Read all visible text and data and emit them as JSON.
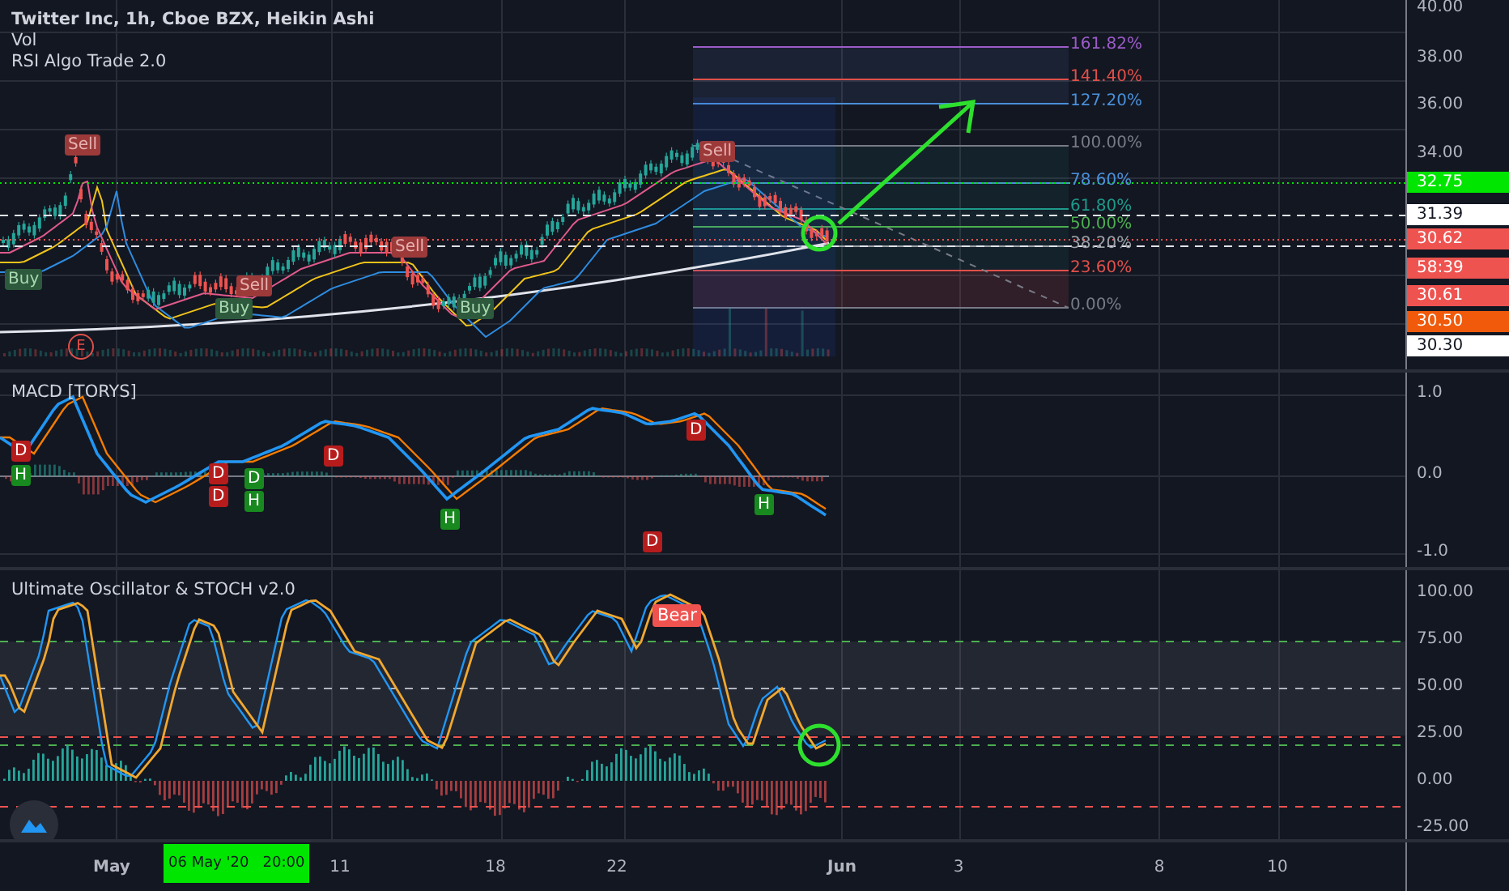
{
  "chart": {
    "legend": {
      "title": "Twitter Inc, 1h, Cboe BZX, Heikin Ashi",
      "indicators": [
        "Vol",
        "RSI Algo Trade 2.0"
      ]
    },
    "price_axis": [
      {
        "label": "40.00",
        "kind": "tick"
      },
      {
        "label": "38.00",
        "kind": "tick"
      },
      {
        "label": "36.00",
        "kind": "tick"
      },
      {
        "label": "34.00",
        "kind": "tick"
      },
      {
        "label": "32.75",
        "kind": "badge",
        "color": "#00e600"
      },
      {
        "label": "31.39",
        "kind": "badge",
        "color": "#ffffff"
      },
      {
        "label": "30.62",
        "kind": "badge",
        "color": "#ef5350"
      },
      {
        "label": "58:39",
        "kind": "badge",
        "color": "#ef5350"
      },
      {
        "label": "30.61",
        "kind": "badge",
        "color": "#ef5350"
      },
      {
        "label": "30.50",
        "kind": "badge",
        "color": "#f05a0a"
      },
      {
        "label": "30.30",
        "kind": "badge",
        "color": "#ffffff"
      }
    ],
    "fib_levels": [
      {
        "label": "161.82%",
        "color": "#9c5cc8"
      },
      {
        "label": "141.40%",
        "color": "#e0504a"
      },
      {
        "label": "127.20%",
        "color": "#4a90d9"
      },
      {
        "label": "100.00%",
        "color": "#787b86"
      },
      {
        "label": "78.60%",
        "color": "#4a90d9"
      },
      {
        "label": "61.80%",
        "color": "#1e9a8a"
      },
      {
        "label": "50.00%",
        "color": "#4caf50"
      },
      {
        "label": "38.20%",
        "color": "#9aa0a6"
      },
      {
        "label": "23.60%",
        "color": "#e0504a"
      },
      {
        "label": "0.00%",
        "color": "#787b86"
      }
    ],
    "signals": [
      {
        "label": "Sell",
        "kind": "sell"
      },
      {
        "label": "Buy",
        "kind": "buy"
      },
      {
        "label": "Sell",
        "kind": "sell"
      },
      {
        "label": "Buy",
        "kind": "buy"
      },
      {
        "label": "Sell",
        "kind": "sell"
      },
      {
        "label": "Buy",
        "kind": "buy"
      },
      {
        "label": "Sell",
        "kind": "sell"
      }
    ],
    "earnings_marker": "E"
  },
  "macd": {
    "title": "MACD [TORYS]",
    "axis": [
      "1.0",
      "0.0",
      "-1.0"
    ],
    "signals": [
      {
        "label": "D",
        "kind": "bearish"
      },
      {
        "label": "H",
        "kind": "bullish"
      },
      {
        "label": "D",
        "kind": "bearish"
      },
      {
        "label": "D",
        "kind": "bearish"
      },
      {
        "label": "D",
        "kind": "bullish"
      },
      {
        "label": "H",
        "kind": "bullish"
      },
      {
        "label": "D",
        "kind": "bearish"
      },
      {
        "label": "H",
        "kind": "bullish"
      },
      {
        "label": "D",
        "kind": "bearish"
      },
      {
        "label": "H",
        "kind": "bullish"
      },
      {
        "label": "D",
        "kind": "bearish"
      }
    ]
  },
  "oscillator": {
    "title": "Ultimate Oscillator & STOCH v2.0",
    "axis": [
      "100.00",
      "75.00",
      "50.00",
      "25.00",
      "0.00",
      "-25.00"
    ],
    "signals": [
      {
        "label": "Bear",
        "kind": "bearish"
      }
    ]
  },
  "time_axis": {
    "labels": [
      {
        "label": "May",
        "kind": "month"
      },
      {
        "label": "11",
        "kind": "day"
      },
      {
        "label": "18",
        "kind": "day"
      },
      {
        "label": "22",
        "kind": "day"
      },
      {
        "label": "Jun",
        "kind": "month"
      },
      {
        "label": "3",
        "kind": "day"
      },
      {
        "label": "8",
        "kind": "day"
      },
      {
        "label": "10",
        "kind": "day"
      }
    ],
    "crosshair": "06 May '20   20:00"
  }
}
